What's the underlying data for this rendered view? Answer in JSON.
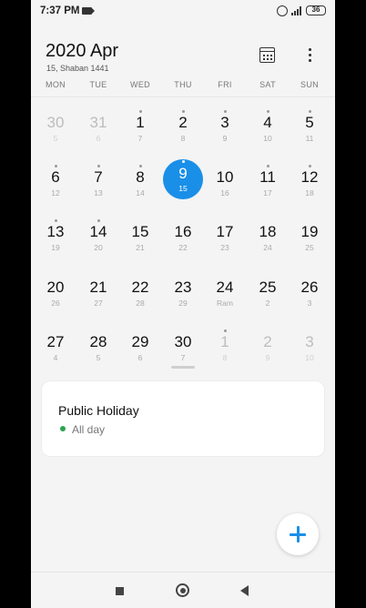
{
  "status_bar": {
    "time": "7:37 PM",
    "battery": "36"
  },
  "header": {
    "title": "2020 Apr",
    "subtitle": "15, Shaban 1441"
  },
  "weekdays": [
    "MON",
    "TUE",
    "WED",
    "THU",
    "FRI",
    "SAT",
    "SUN"
  ],
  "weeks": [
    [
      {
        "d": "30",
        "s": "5",
        "other": true,
        "dot": false
      },
      {
        "d": "31",
        "s": "6",
        "other": true,
        "dot": false
      },
      {
        "d": "1",
        "s": "7",
        "dot": true
      },
      {
        "d": "2",
        "s": "8",
        "dot": true
      },
      {
        "d": "3",
        "s": "9",
        "dot": true
      },
      {
        "d": "4",
        "s": "10",
        "dot": true
      },
      {
        "d": "5",
        "s": "11",
        "dot": true
      }
    ],
    [
      {
        "d": "6",
        "s": "12",
        "dot": true
      },
      {
        "d": "7",
        "s": "13",
        "dot": true
      },
      {
        "d": "8",
        "s": "14",
        "dot": true
      },
      {
        "d": "9",
        "s": "15",
        "today": true,
        "dot": true
      },
      {
        "d": "10",
        "s": "16",
        "dot": false
      },
      {
        "d": "11",
        "s": "17",
        "dot": true
      },
      {
        "d": "12",
        "s": "18",
        "dot": true
      }
    ],
    [
      {
        "d": "13",
        "s": "19",
        "dot": true
      },
      {
        "d": "14",
        "s": "20",
        "dot": true
      },
      {
        "d": "15",
        "s": "21",
        "dot": false
      },
      {
        "d": "16",
        "s": "22",
        "dot": false
      },
      {
        "d": "17",
        "s": "23",
        "dot": false
      },
      {
        "d": "18",
        "s": "24",
        "dot": false
      },
      {
        "d": "19",
        "s": "25",
        "dot": false
      }
    ],
    [
      {
        "d": "20",
        "s": "26",
        "dot": false
      },
      {
        "d": "21",
        "s": "27",
        "dot": false
      },
      {
        "d": "22",
        "s": "28",
        "dot": false
      },
      {
        "d": "23",
        "s": "29",
        "dot": false
      },
      {
        "d": "24",
        "s": "Ram",
        "dot": false
      },
      {
        "d": "25",
        "s": "2",
        "dot": false
      },
      {
        "d": "26",
        "s": "3",
        "dot": false
      }
    ],
    [
      {
        "d": "27",
        "s": "4",
        "dot": false
      },
      {
        "d": "28",
        "s": "5",
        "dot": false
      },
      {
        "d": "29",
        "s": "6",
        "dot": false
      },
      {
        "d": "30",
        "s": "7",
        "dot": false
      },
      {
        "d": "1",
        "s": "8",
        "other": true,
        "dot": true
      },
      {
        "d": "2",
        "s": "9",
        "other": true,
        "dot": false
      },
      {
        "d": "3",
        "s": "10",
        "other": true,
        "dot": false
      }
    ]
  ],
  "event": {
    "title": "Public Holiday",
    "time": "All day",
    "dot_color": "#2aa44f"
  },
  "colors": {
    "accent": "#1a8fe8"
  },
  "icons": [
    "calendar-today-icon",
    "more-vert-icon",
    "add-icon",
    "recents-icon",
    "home-icon",
    "back-icon"
  ]
}
